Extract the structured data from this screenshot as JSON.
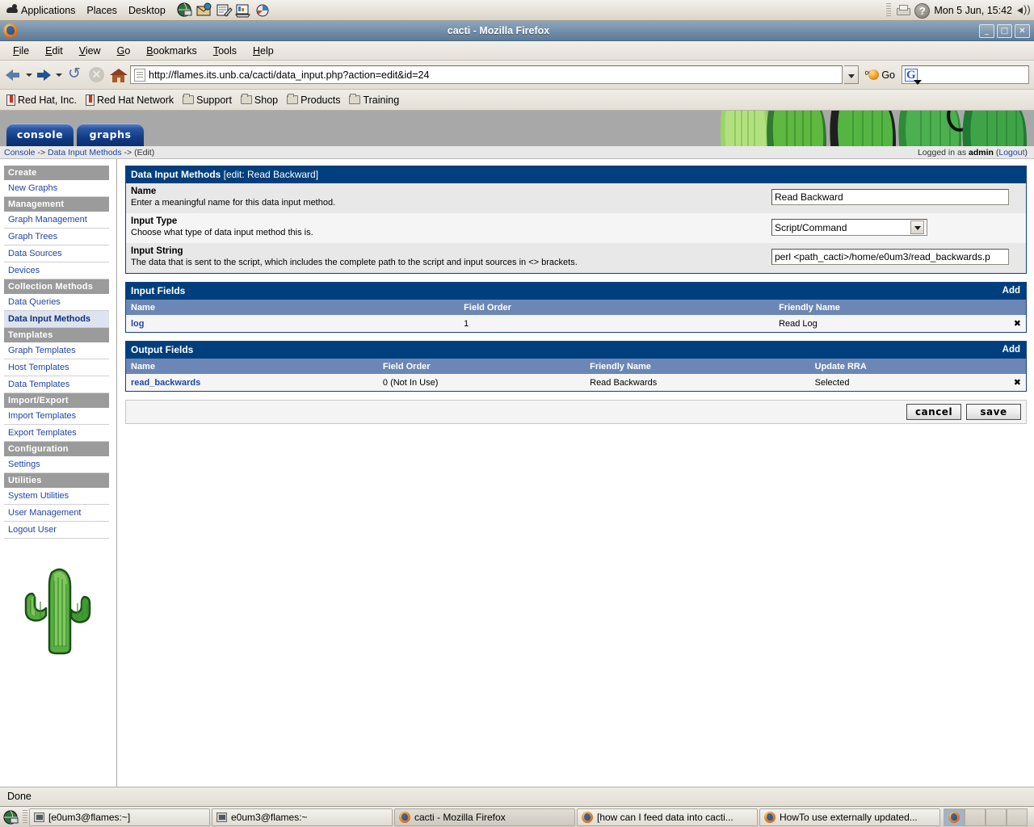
{
  "desktop": {
    "menus": [
      "Applications",
      "Places",
      "Desktop"
    ],
    "launchers": [
      "web-browser-icon",
      "email-icon",
      "text-editor-icon",
      "presentation-icon",
      "chart-icon"
    ],
    "tray": {
      "printer": "printer-icon",
      "help": "?",
      "clock": "Mon  5 Jun, 15:42",
      "volume": "volume-icon"
    }
  },
  "browser": {
    "title": "cacti - Mozilla Firefox",
    "window_buttons": {
      "minimize": "_",
      "maximize": "□",
      "close": "✕"
    },
    "menubar": [
      "File",
      "Edit",
      "View",
      "Go",
      "Bookmarks",
      "Tools",
      "Help"
    ],
    "url": "http://flames.its.unb.ca/cacti/data_input.php?action=edit&id=24",
    "go_label": "Go",
    "search_placeholder": "",
    "search_value": "",
    "bookmarks": [
      {
        "label": "Red Hat, Inc.",
        "icon": "bookmark-icon"
      },
      {
        "label": "Red Hat Network",
        "icon": "bookmark-icon"
      },
      {
        "label": "Support",
        "icon": "folder-icon"
      },
      {
        "label": "Shop",
        "icon": "folder-icon"
      },
      {
        "label": "Products",
        "icon": "folder-icon"
      },
      {
        "label": "Training",
        "icon": "folder-icon"
      }
    ],
    "status": "Done"
  },
  "cacti": {
    "tabs": [
      {
        "label": "console",
        "active": true
      },
      {
        "label": "graphs",
        "active": false
      }
    ],
    "breadcrumb": {
      "console": "Console",
      "sep1": " -> ",
      "section": "Data Input Methods",
      "sep2": " -> ",
      "current": "(Edit)"
    },
    "login": {
      "prefix": "Logged in as ",
      "user": "admin",
      "logout_open": " (",
      "logout": "Logout",
      "logout_close": ")"
    },
    "sidebar": [
      {
        "type": "header",
        "label": "Create"
      },
      {
        "type": "link",
        "label": "New Graphs",
        "current": false
      },
      {
        "type": "header",
        "label": "Management"
      },
      {
        "type": "link",
        "label": "Graph Management",
        "current": false
      },
      {
        "type": "link",
        "label": "Graph Trees",
        "current": false
      },
      {
        "type": "link",
        "label": "Data Sources",
        "current": false
      },
      {
        "type": "link",
        "label": "Devices",
        "current": false
      },
      {
        "type": "header",
        "label": "Collection Methods"
      },
      {
        "type": "link",
        "label": "Data Queries",
        "current": false
      },
      {
        "type": "link",
        "label": "Data Input Methods",
        "current": true
      },
      {
        "type": "header",
        "label": "Templates"
      },
      {
        "type": "link",
        "label": "Graph Templates",
        "current": false
      },
      {
        "type": "link",
        "label": "Host Templates",
        "current": false
      },
      {
        "type": "link",
        "label": "Data Templates",
        "current": false
      },
      {
        "type": "header",
        "label": "Import/Export"
      },
      {
        "type": "link",
        "label": "Import Templates",
        "current": false
      },
      {
        "type": "link",
        "label": "Export Templates",
        "current": false
      },
      {
        "type": "header",
        "label": "Configuration"
      },
      {
        "type": "link",
        "label": "Settings",
        "current": false
      },
      {
        "type": "header",
        "label": "Utilities"
      },
      {
        "type": "link",
        "label": "System Utilities",
        "current": false
      },
      {
        "type": "link",
        "label": "User Management",
        "current": false
      },
      {
        "type": "link",
        "label": "Logout User",
        "current": false
      }
    ],
    "form_panel": {
      "title": "Data Input Methods",
      "subtitle": " [edit: Read Backward]",
      "rows": [
        {
          "label": "Name",
          "desc": "Enter a meaningful name for this data input method.",
          "control": "text",
          "value": "Read Backward"
        },
        {
          "label": "Input Type",
          "desc": "Choose what type of data input method this is.",
          "control": "select",
          "value": "Script/Command"
        },
        {
          "label": "Input String",
          "desc": "The data that is sent to the script, which includes the complete path to the script and input sources in <> brackets.",
          "control": "text",
          "value": "perl <path_cacti>/home/e0um3/read_backwards.p"
        }
      ]
    },
    "input_fields": {
      "title": "Input Fields",
      "add_label": "Add",
      "columns": [
        "Name",
        "Field Order",
        "Friendly Name",
        ""
      ],
      "rows": [
        {
          "name": "log",
          "field_order": "1",
          "friendly_name": "Read Log",
          "delete": "✖"
        }
      ]
    },
    "output_fields": {
      "title": "Output Fields",
      "add_label": "Add",
      "columns": [
        "Name",
        "Field Order",
        "Friendly Name",
        "Update RRA",
        ""
      ],
      "rows": [
        {
          "name": "read_backwards",
          "field_order": "0 (Not In Use)",
          "friendly_name": "Read Backwards",
          "update_rra": "Selected",
          "delete": "✖"
        }
      ]
    },
    "actions": {
      "cancel": "cancel",
      "save": "save"
    }
  },
  "taskbar": {
    "items": [
      {
        "label": "[e0um3@flames:~]",
        "icon": "terminal-icon",
        "active": false
      },
      {
        "label": "e0um3@flames:~",
        "icon": "terminal-icon",
        "active": false
      },
      {
        "label": "cacti - Mozilla Firefox",
        "icon": "firefox-icon",
        "active": true
      },
      {
        "label": "[how can I feed data into cacti...",
        "icon": "firefox-icon",
        "active": false
      },
      {
        "label": "HowTo use externally updated...",
        "icon": "firefox-icon",
        "active": false
      }
    ]
  },
  "colors": {
    "panel_header": "#003f7d",
    "table_header": "#6c87b5",
    "link": "#2145a3",
    "nav_header": "#9b9b9b",
    "delete": "#dd2b10",
    "tab_blue": "#123d87"
  }
}
